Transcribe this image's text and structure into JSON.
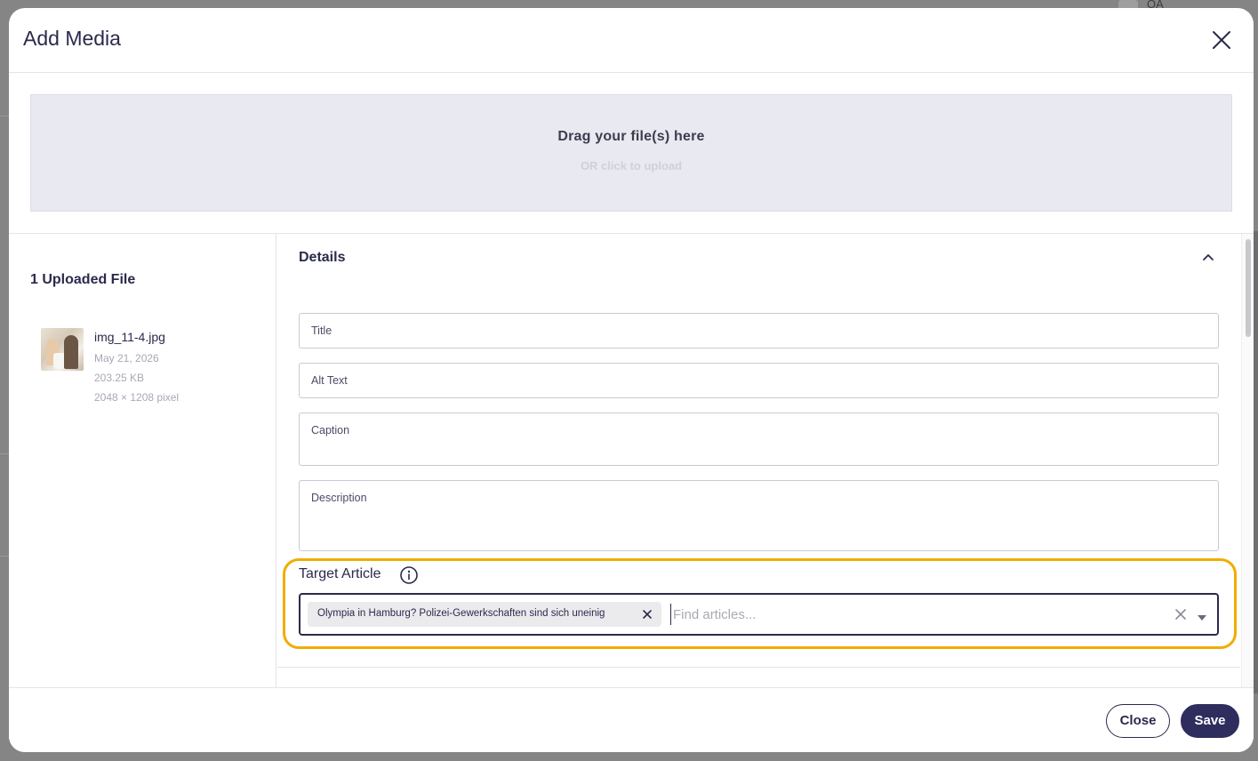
{
  "backdrop": {
    "user_initials": "QA"
  },
  "modal": {
    "title": "Add Media"
  },
  "dropzone": {
    "title": "Drag your file(s) here",
    "subtitle": "OR click to upload"
  },
  "uploads": {
    "heading": "1 Uploaded File",
    "files": [
      {
        "name": "img_11-4.jpg",
        "date": "May 21, 2026",
        "size": "203.25 KB",
        "dimensions": "2048 × 1208 pixel"
      }
    ]
  },
  "details": {
    "heading": "Details",
    "fields": {
      "title": "Title",
      "alt_text": "Alt Text",
      "caption": "Caption",
      "description": "Description"
    },
    "target_article": {
      "label": "Target Article",
      "selected_chip": "Olympia in Hamburg? Polizei-Gewerkschaften sind sich uneinig",
      "placeholder": "Find articles..."
    }
  },
  "footer": {
    "close_label": "Close",
    "save_label": "Save"
  },
  "colors": {
    "primary": "#2e2d5e",
    "highlight": "#f2ac00",
    "dropzone_bg": "#e9e9f1"
  },
  "icons": [
    "close-icon",
    "chevron-up-icon",
    "info-icon",
    "chip-remove-icon",
    "clear-icon",
    "caret-down-icon"
  ]
}
